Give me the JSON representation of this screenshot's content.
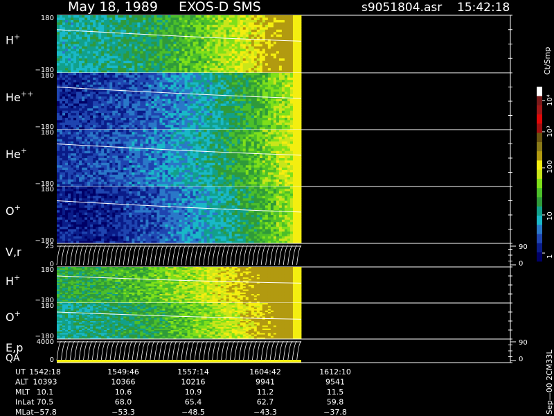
{
  "header": {
    "date": "May 18, 1989",
    "instrument": "EXOS-D SMS",
    "filename": "s9051804.asr",
    "time": "15:42:18"
  },
  "colorbar": {
    "unit_label": "Ct/Smp",
    "tick_labels": [
      "10⁴",
      "10³",
      "100",
      "10",
      "1"
    ],
    "colors": [
      "#000066",
      "#0a1c88",
      "#1f45b0",
      "#2a78c8",
      "#19b8c8",
      "#12a08a",
      "#2f9a3a",
      "#4cbf2a",
      "#7fe01a",
      "#c9e61a",
      "#f4ee10",
      "#b29a10",
      "#8a7a18",
      "#6a5410",
      "#a01010",
      "#e00808",
      "#a01818",
      "#7a1a1a",
      "#ffffff"
    ]
  },
  "side_label": "Sep—00 2CM33L",
  "footer": {
    "row_labels": [
      "UT",
      "ALT",
      "MLT",
      "InLat",
      "MLat"
    ],
    "rows": [
      [
        "1542:18",
        "1549:46",
        "1557:14",
        "1604:42",
        "1612:10"
      ],
      [
        "10393",
        "10366",
        "10216",
        "9941",
        "9541"
      ],
      [
        "10.1",
        "10.6",
        "10.9",
        "11.2",
        "11.5"
      ],
      [
        "70.5",
        "68.0",
        "65.4",
        "62.7",
        "59.8"
      ],
      [
        "−57.8",
        "−53.3",
        "−48.5",
        "−43.3",
        "−37.8"
      ]
    ]
  },
  "chart_data": {
    "type": "heatmap",
    "x_ut": [
      "1542:18",
      "1549:46",
      "1557:14",
      "1604:42",
      "1612:10"
    ],
    "panels": [
      {
        "label": "H",
        "sup": "+",
        "y_top": "180",
        "y_bottom": "−180",
        "colormap": "count",
        "base_level": 0.42
      },
      {
        "label": "He",
        "sup": "++",
        "y_top": "180",
        "y_bottom": "−180",
        "colormap": "count",
        "base_level": 0.12
      },
      {
        "label": "He",
        "sup": "+",
        "y_top": "180",
        "y_bottom": "−180",
        "colormap": "count",
        "base_level": 0.16
      },
      {
        "label": "O",
        "sup": "+",
        "y_top": "180",
        "y_bottom": "−180",
        "colormap": "count",
        "base_level": 0.08
      },
      {
        "label": "V,r",
        "sup": "",
        "y_top": "25",
        "y_bottom": "0",
        "colormap": "lines",
        "right_top": "90",
        "right_bottom": "0"
      },
      {
        "label": "H",
        "sup": "+",
        "y_top": "180",
        "y_bottom": "−180",
        "colormap": "count",
        "base_level": 0.55
      },
      {
        "label": "O",
        "sup": "+",
        "y_top": "180",
        "y_bottom": "−180",
        "colormap": "count",
        "base_level": 0.45
      },
      {
        "label": "E,p",
        "sup": "",
        "label2": "QA",
        "y_top": "4000",
        "y_bottom": "0",
        "colormap": "lines",
        "right_top": "90",
        "right_bottom": "0"
      }
    ]
  }
}
